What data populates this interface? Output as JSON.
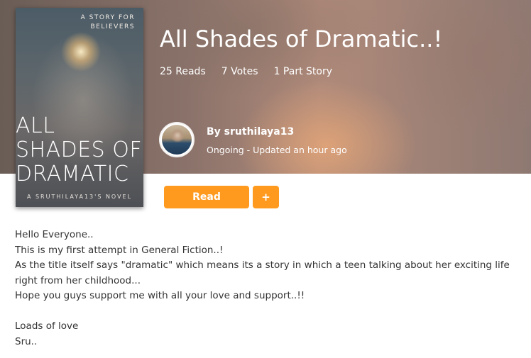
{
  "story": {
    "title": "All Shades of Dramatic..!",
    "stats": {
      "reads": "25 Reads",
      "votes": "7 Votes",
      "parts": "1 Part Story"
    },
    "author": {
      "name": "By sruthilaya13",
      "status": "Ongoing - Updated an hour ago"
    }
  },
  "cover": {
    "tagline_line1": "A STORY FOR",
    "tagline_line2": "BELIEVERS",
    "title_line1": "ALL",
    "title_line2": "SHADES OF",
    "title_line3": "DRAMATIC",
    "author_line": "A SRUTHILAYA13'S NOVEL"
  },
  "actions": {
    "read_label": "Read",
    "add_label": "+"
  },
  "description": {
    "lines": [
      "Hello Everyone..",
      "This is my first attempt in General Fiction..!",
      "As the title itself says \"dramatic\" which means its a story in which a teen talking about her exciting life",
      "right from her childhood...",
      "Hope you guys support me with all your love and support..!!",
      "Loads of love",
      "Sru.."
    ]
  },
  "colors": {
    "accent": "#ff9a1f",
    "body_text": "#333333"
  }
}
